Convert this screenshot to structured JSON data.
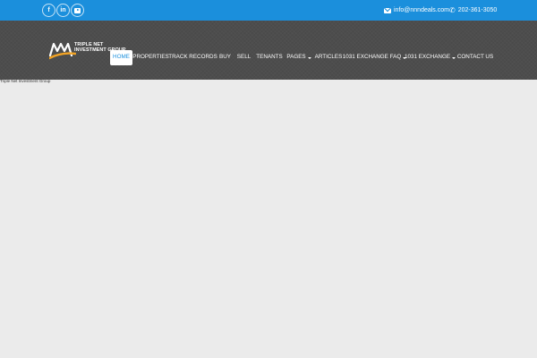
{
  "topbar": {
    "social": [
      {
        "name": "facebook",
        "glyph": "f",
        "icon": "facebook-icon"
      },
      {
        "name": "linkedin",
        "glyph": "in",
        "icon": "linkedin-icon"
      },
      {
        "name": "youtube",
        "glyph": "",
        "icon": "youtube-icon"
      }
    ],
    "email": "info@nnndeals.com",
    "phone": "202-361-3050"
  },
  "logo": {
    "line1": "TRIPLE NET",
    "line2": "INVESTMENT GROUP"
  },
  "nav": {
    "items": [
      {
        "label": "HOME",
        "active": true,
        "dropdown": false
      },
      {
        "label": "PROPERTIES",
        "active": false,
        "dropdown": false
      },
      {
        "label": "TRACK RECORDS",
        "active": false,
        "dropdown": false
      },
      {
        "label": "BUY",
        "active": false,
        "dropdown": false
      },
      {
        "label": "SELL",
        "active": false,
        "dropdown": false
      },
      {
        "label": "TENANTS",
        "active": false,
        "dropdown": false
      },
      {
        "label": "PAGES",
        "active": false,
        "dropdown": true
      },
      {
        "label": "ARTICLES",
        "active": false,
        "dropdown": false
      },
      {
        "label": "1031 EXCHANGE FAQ",
        "active": false,
        "dropdown": true
      },
      {
        "label": "1031 EXCHANGE",
        "active": false,
        "dropdown": true
      },
      {
        "label": "CONTACT US",
        "active": false,
        "dropdown": false
      }
    ]
  },
  "page": {
    "label": "Triple Net Investment Group"
  },
  "colors": {
    "topbar": "#1b8fdc",
    "header": "#4d4d4d",
    "body": "#ebebeb",
    "logo_accent": "#f2a324"
  }
}
